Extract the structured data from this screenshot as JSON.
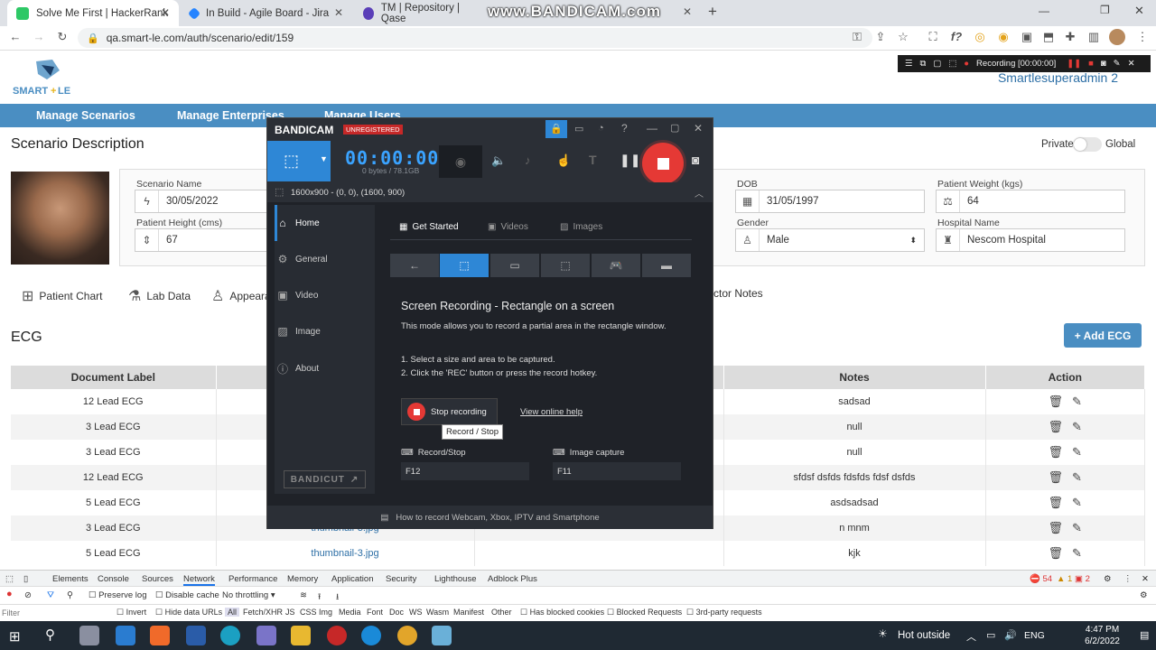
{
  "browser": {
    "tabs": [
      {
        "title": "Solve Me First | HackerRank",
        "color": "#2ec866"
      },
      {
        "title": "In Build - Agile Board - Jira",
        "color": "#2684ff"
      },
      {
        "title": "TM | Repository | Qase",
        "color": "#5a3eb8"
      }
    ],
    "new_tab": "+",
    "url": "qa.smart-le.com/auth/scenario/edit/159",
    "watermark": "www.BANDICAM.com"
  },
  "app": {
    "logo_text": "SMART+LE",
    "user_name": "Smartlesuperadmin 2",
    "nav": [
      "Manage Scenarios",
      "Manage Enterprises",
      "Manage Users"
    ],
    "scenario_title": "Scenario Description",
    "toggle_left": "Private",
    "toggle_right": "Global",
    "fields": {
      "scenario_name_label": "Scenario Name",
      "scenario_name_value": "30/05/2022",
      "patient_height_label": "Patient Height (cms)",
      "patient_height_value": "67",
      "dob_label": "DOB",
      "dob_value": "31/05/1997",
      "gender_label": "Gender",
      "gender_value": "Male",
      "patient_weight_label": "Patient Weight (kgs)",
      "patient_weight_value": "64",
      "hospital_label": "Hospital Name",
      "hospital_value": "Nescom Hospital"
    },
    "patient_tabs": [
      "Patient Chart",
      "Lab Data",
      "Appeara",
      "ctor Notes"
    ],
    "ecg_title": "ECG",
    "add_ecg": "+ Add ECG",
    "table": {
      "headers": [
        "Document Label",
        "",
        "",
        "Notes",
        "Action"
      ],
      "rows": [
        {
          "label": "12 Lead ECG",
          "file": "",
          "notes": "sadsad"
        },
        {
          "label": "3 Lead ECG",
          "file": "",
          "notes": "null"
        },
        {
          "label": "3 Lead ECG",
          "file": "",
          "notes": "null"
        },
        {
          "label": "12 Lead ECG",
          "file": "",
          "notes": "sfdsf dsfds fdsfds fdsf dsfds"
        },
        {
          "label": "5 Lead ECG",
          "file": "",
          "notes": "asdsadsad"
        },
        {
          "label": "3 Lead ECG",
          "file": "thumbnail-3.jpg",
          "notes": "n mnm"
        },
        {
          "label": "5 Lead ECG",
          "file": "thumbnail-3.jpg",
          "notes": "kjk"
        }
      ]
    }
  },
  "bandicam": {
    "title": "BANDICAM",
    "badge": "UNREGISTERED",
    "timer": "00:00:00",
    "bytes": "0 bytes / 78.1GB",
    "resolution": "1600x900 - (0, 0), (1600, 900)",
    "side": [
      "Home",
      "General",
      "Video",
      "Image",
      "About"
    ],
    "tabs": [
      "Get Started",
      "Videos",
      "Images"
    ],
    "heading": "Screen Recording - Rectangle on a screen",
    "desc": "This mode allows you to record a partial area in the rectangle window.",
    "step1": "1. Select a size and area to be captured.",
    "step2": "2. Click the 'REC' button or press the record hotkey.",
    "stop_btn": "Stop recording",
    "help_link": "View online help",
    "tooltip": "Record / Stop",
    "hk_record_label": "Record/Stop",
    "hk_record_value": "F12",
    "hk_image_label": "Image capture",
    "hk_image_value": "F11",
    "bandicut": "BANDICUT",
    "footer": "How to record Webcam, Xbox, IPTV and Smartphone",
    "mini_status": "Recording [00:00:00]"
  },
  "devtools": {
    "tabs": [
      "Elements",
      "Console",
      "Sources",
      "Network",
      "Performance",
      "Memory",
      "Application",
      "Security",
      "Lighthouse",
      "Adblock Plus"
    ],
    "errors": "54",
    "warnings": "1",
    "issues": "2",
    "preserve_log": "Preserve log",
    "disable_cache": "Disable cache",
    "throttling": "No throttling",
    "filter_placeholder": "Filter",
    "invert": "Invert",
    "hide_data_urls": "Hide data URLs",
    "filters": [
      "All",
      "Fetch/XHR",
      "JS",
      "CSS",
      "Img",
      "Media",
      "Font",
      "Doc",
      "WS",
      "Wasm",
      "Manifest",
      "Other"
    ],
    "has_blocked_cookies": "Has blocked cookies",
    "blocked_requests": "Blocked Requests",
    "third_party": "3rd-party requests"
  },
  "taskbar": {
    "weather": "Hot outside",
    "lang": "ENG",
    "time": "4:47 PM",
    "date": "6/2/2022"
  }
}
